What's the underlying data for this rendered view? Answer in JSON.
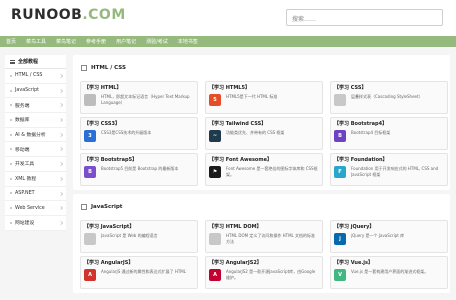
{
  "header": {
    "logo_part1": "RUNOOB",
    "logo_part2": ".COM",
    "search_placeholder": "搜索……"
  },
  "nav": {
    "items": [
      "首页",
      "菜鸟工具",
      "菜鸟笔记",
      "参考手册",
      "用户笔记",
      "测验/考试",
      "本地书签"
    ]
  },
  "sidebar": {
    "title": "全部教程",
    "items": [
      "HTML / CSS",
      "JavaScript",
      "服务端",
      "数据库",
      "AI & 数据分析",
      "移动端",
      "开发工具",
      "XML 教程",
      "ASP.NET",
      "Web Service",
      "网站建设"
    ]
  },
  "sections": [
    {
      "title": "HTML / CSS",
      "cards": [
        {
          "title": "【学习 HTML】",
          "desc": "HTML，即超文本标记语言（Hyper Text Markup Language）",
          "icon": "html-icon",
          "color": "#bdbdbd",
          "glyph": ""
        },
        {
          "title": "【学习 HTML5】",
          "desc": "HTML5是下一代 HTML 标准",
          "icon": "html5-icon",
          "color": "#e44d26",
          "glyph": "5"
        },
        {
          "title": "【学习 CSS】",
          "desc": "层叠样式表（Cascading StyleSheet）",
          "icon": "css-icon",
          "color": "#c8c8c8",
          "glyph": ""
        },
        {
          "title": "【学习 CSS3】",
          "desc": "CSS3是CSS技术的升级版本",
          "icon": "css3-icon",
          "color": "#2a6fd4",
          "glyph": "3"
        },
        {
          "title": "【学习 Tailwind CSS】",
          "desc": "功能类优先、并带有的 CSS 框架",
          "icon": "tailwind-icon",
          "color": "#1f3a4d",
          "glyph": "~"
        },
        {
          "title": "【学习 Bootstrap4】",
          "desc": "Bootstrap4 目标框架",
          "icon": "bootstrap4-icon",
          "color": "#6f42c1",
          "glyph": "B"
        },
        {
          "title": "【学习 Bootstrap5】",
          "desc": "Bootstrap5 目前是 Bootstrap 的最新版本",
          "icon": "bootstrap5-icon",
          "color": "#7b4ecc",
          "glyph": "B"
        },
        {
          "title": "【学习 Font Awesome】",
          "desc": "Font Awesome 是一套绝佳的图标字体库和 CSS框架。",
          "icon": "font-awesome-icon",
          "color": "#1b1b1b",
          "glyph": "⚑"
        },
        {
          "title": "【学习 Foundation】",
          "desc": "Foundation 用于开发响应式的 HTML, CSS and JavaScript 框架",
          "icon": "foundation-icon",
          "color": "#2ba6cb",
          "glyph": "F"
        }
      ]
    },
    {
      "title": "JavaScript",
      "cards": [
        {
          "title": "【学习 JavaScript】",
          "desc": "JavaScript 是 Web 的编程语言",
          "icon": "javascript-icon",
          "color": "#c8c8c8",
          "glyph": ""
        },
        {
          "title": "【学习 HTML DOM】",
          "desc": "HTML DOM 定义了访问和操作 HTML 文档的标准方法",
          "icon": "html-dom-icon",
          "color": "#c8c8c8",
          "glyph": ""
        },
        {
          "title": "【学习 jQuery】",
          "desc": "jQuery 是一个 JavaScript 库",
          "icon": "jquery-icon",
          "color": "#0769ad",
          "glyph": "j"
        },
        {
          "title": "【学习 AngularJS】",
          "desc": "AngularJS 通过新的属性和表达式扩展了 HTML",
          "icon": "angularjs-icon",
          "color": "#d0342c",
          "glyph": "A"
        },
        {
          "title": "【学习 AngularJS2】",
          "desc": "AngularJS2 是一款开源JavaScript库，由Google维护。",
          "icon": "angularjs2-icon",
          "color": "#c3002f",
          "glyph": "A"
        },
        {
          "title": "【学习 Vue.js】",
          "desc": "Vue.js 是一套构建用户界面的渐进式框架。",
          "icon": "vue-icon",
          "color": "#41b883",
          "glyph": "V"
        }
      ]
    }
  ]
}
